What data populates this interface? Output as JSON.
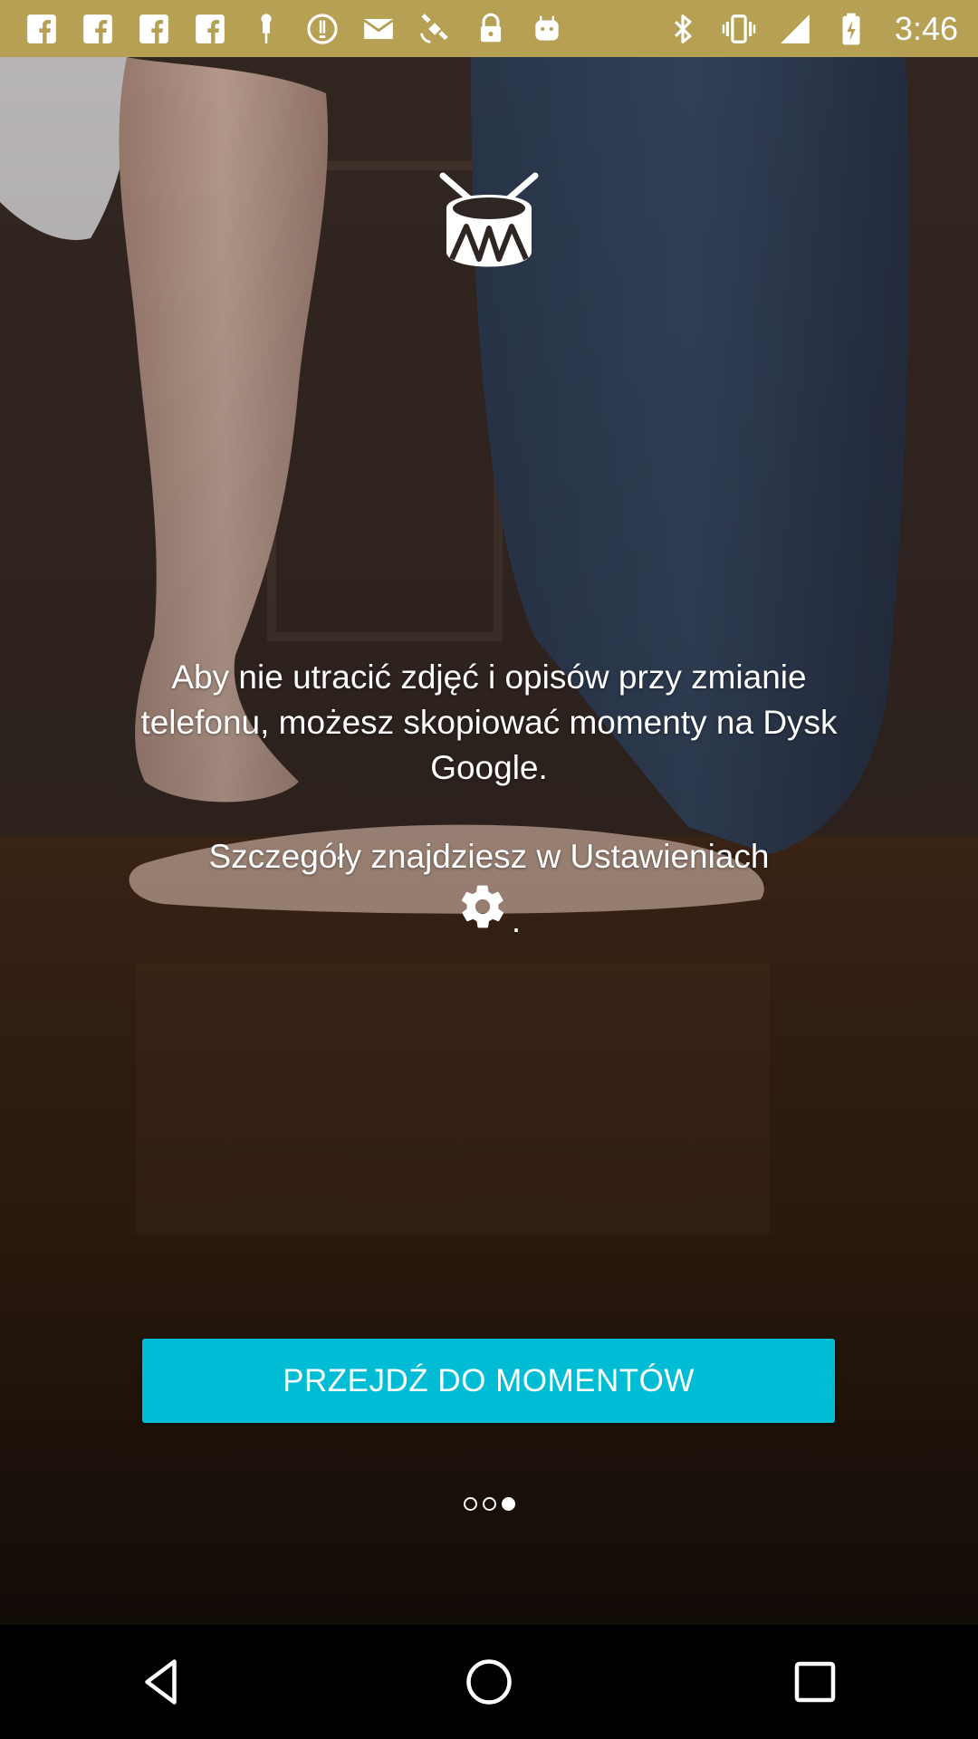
{
  "status_bar": {
    "time": "3:46",
    "left_icons": [
      "facebook-icon",
      "facebook-icon",
      "facebook-icon",
      "facebook-icon",
      "pin-icon",
      "alert-icon",
      "mail-icon",
      "satellite-icon",
      "lock-icon",
      "android-icon"
    ],
    "right_icons": [
      "bluetooth-icon",
      "vibrate-icon",
      "signal-icon",
      "battery-icon"
    ],
    "color": "#b5a054"
  },
  "content": {
    "message_line1": "Aby nie utracić zdjęć i opisów przy zmianie telefonu, możesz skopiować momenty na Dysk Google.",
    "message_line2": "Szczegóły znajdziesz w Ustawieniach",
    "message_suffix": ".",
    "settings_icon": "gear-icon",
    "logo_icon": "drum-icon"
  },
  "cta": {
    "label": "PRZEJDŹ DO MOMENTÓW",
    "color": "#00bcd4"
  },
  "pager": {
    "count": 3,
    "active_index": 2
  },
  "nav_bar": {
    "buttons": [
      "back-icon",
      "home-icon",
      "recents-icon"
    ]
  }
}
